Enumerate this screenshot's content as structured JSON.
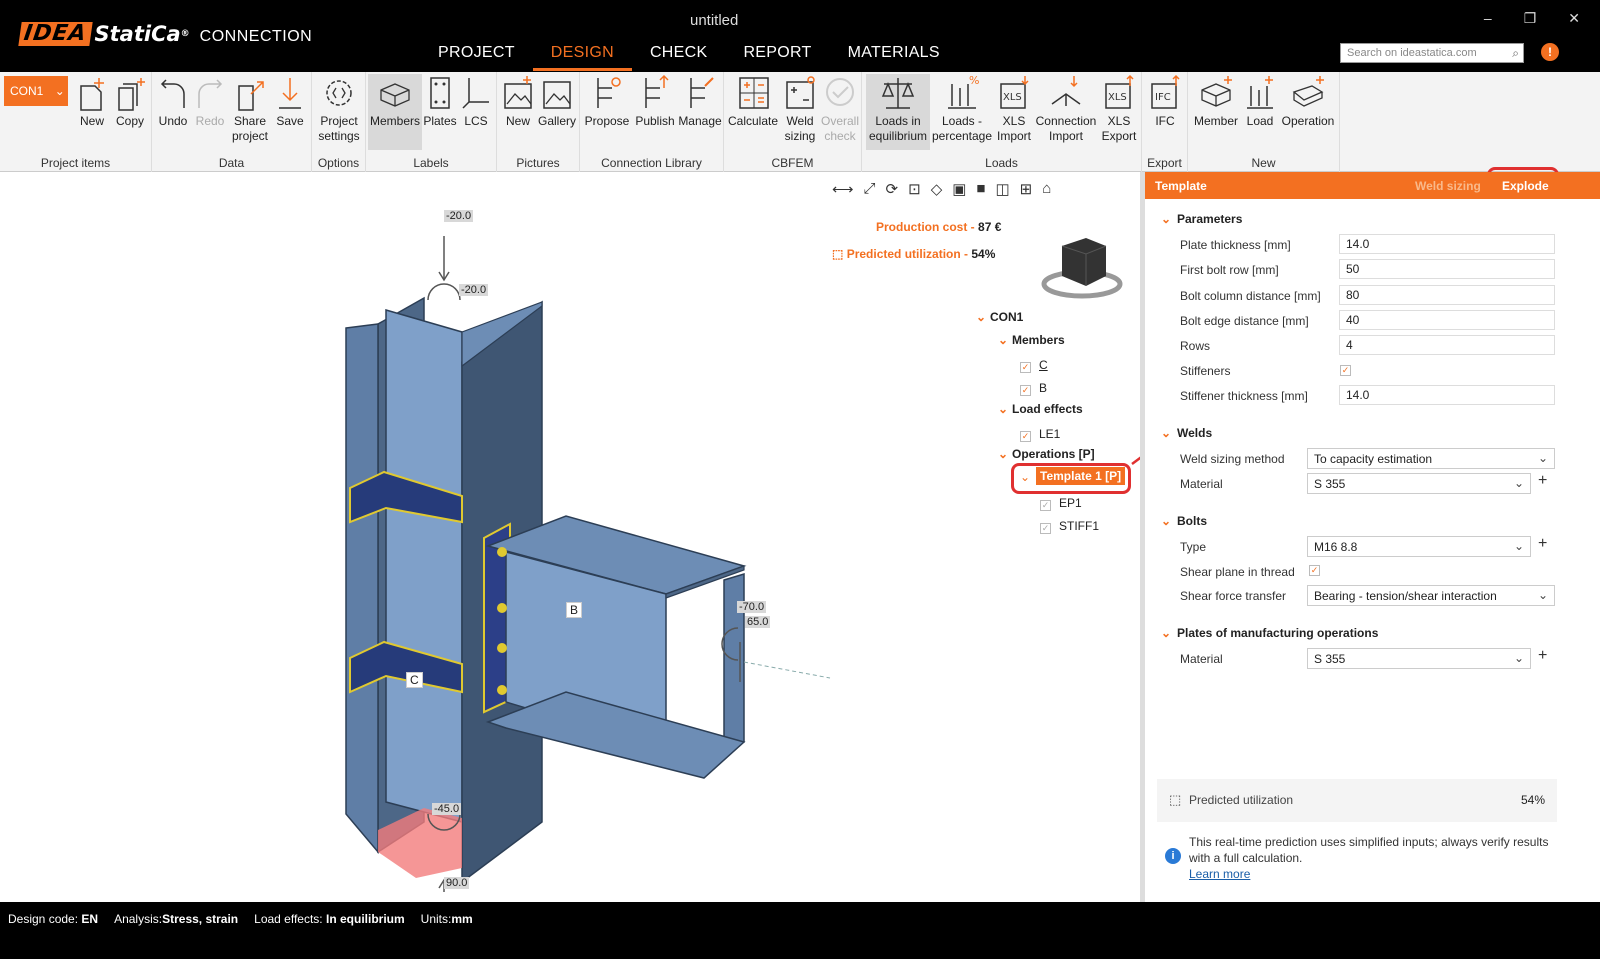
{
  "app": {
    "logo_idea": "IDEA",
    "logo_statica": "StatiCa",
    "logo_reg": "®",
    "logo_product": "CONNECTION",
    "window_title": "untitled",
    "window_controls": {
      "minimize": "–",
      "maximize": "❐",
      "close": "✕"
    },
    "search_placeholder": "Search on ideastatica.com",
    "info_label": "!"
  },
  "nav": {
    "tabs": [
      "PROJECT",
      "DESIGN",
      "CHECK",
      "REPORT",
      "MATERIALS"
    ],
    "active": "DESIGN"
  },
  "ribbon": {
    "connection_select": "CON1",
    "groups": {
      "project_items": {
        "title": "Project items",
        "new": "New",
        "copy": "Copy"
      },
      "data": {
        "title": "Data",
        "undo": "Undo",
        "redo": "Redo",
        "share": "Share project",
        "save": "Save"
      },
      "options": {
        "title": "Options",
        "settings": "Project settings"
      },
      "labels": {
        "title": "Labels",
        "members": "Members",
        "plates": "Plates",
        "lcs": "LCS"
      },
      "pictures": {
        "title": "Pictures",
        "new": "New",
        "gallery": "Gallery"
      },
      "library": {
        "title": "Connection Library",
        "propose": "Propose",
        "publish": "Publish",
        "manage": "Manage"
      },
      "cbfem": {
        "title": "CBFEM",
        "calculate": "Calculate",
        "weld_sizing": "Weld sizing",
        "overall_check": "Overall check"
      },
      "loads": {
        "title": "Loads",
        "equilibrium": "Loads in equilibrium",
        "percentage": "Loads - percentage",
        "xls_import": "XLS Import",
        "conn_import": "Connection Import",
        "xls_export": "XLS Export"
      },
      "export": {
        "title": "Export",
        "ifc": "IFC"
      },
      "new": {
        "title": "New",
        "member": "Member",
        "load": "Load",
        "operation": "Operation"
      }
    }
  },
  "viewport": {
    "production_cost_label": "Production cost",
    "production_cost_value": "87 €",
    "predicted_label": "Predicted utilization",
    "predicted_value": "54%",
    "load_labels": {
      "top1": "-20.0",
      "top2": "-20.0",
      "right1": "-70.0",
      "right2": "65.0",
      "bottom1": "-45.0",
      "bottom2": "90.0"
    },
    "member_labels": {
      "b": "B",
      "c": "C"
    },
    "tree": {
      "root": "CON1",
      "members": "Members",
      "member_c": "C",
      "member_b": "B",
      "load_effects": "Load effects",
      "le1": "LE1",
      "operations": "Operations [P]",
      "template": "Template 1 [P]",
      "ep1": "EP1",
      "stiff1": "STIFF1"
    }
  },
  "panel": {
    "header": "Template",
    "weld_sizing": "Weld sizing",
    "explode": "Explode",
    "parameters": {
      "title": "Parameters",
      "plate_thickness_label": "Plate thickness [mm]",
      "plate_thickness": "14.0",
      "first_bolt_row_label": "First bolt row [mm]",
      "first_bolt_row": "50",
      "bolt_col_dist_label": "Bolt column distance [mm]",
      "bolt_col_dist": "80",
      "bolt_edge_dist_label": "Bolt edge distance [mm]",
      "bolt_edge_dist": "40",
      "rows_label": "Rows",
      "rows": "4",
      "stiffeners_label": "Stiffeners",
      "stiffener_thickness_label": "Stiffener thickness [mm]",
      "stiffener_thickness": "14.0"
    },
    "welds": {
      "title": "Welds",
      "method_label": "Weld sizing method",
      "method": "To capacity estimation",
      "material_label": "Material",
      "material": "S 355"
    },
    "bolts": {
      "title": "Bolts",
      "type_label": "Type",
      "type": "M16 8.8",
      "shear_plane_label": "Shear plane in thread",
      "transfer_label": "Shear force transfer",
      "transfer": "Bearing - tension/shear interaction"
    },
    "plates": {
      "title": "Plates of manufacturing operations",
      "material_label": "Material",
      "material": "S 355"
    },
    "prediction": {
      "label": "Predicted utilization",
      "value": "54%",
      "note": "This real-time prediction uses simplified inputs; always verify results with a full calculation.",
      "learn_more": "Learn more"
    }
  },
  "status": {
    "design_code_label": "Design code:",
    "design_code": "EN",
    "analysis_label": "Analysis:",
    "analysis": "Stress, strain",
    "load_effects_label": "Load effects:",
    "load_effects": "In equilibrium",
    "units_label": "Units:",
    "units": "mm"
  }
}
